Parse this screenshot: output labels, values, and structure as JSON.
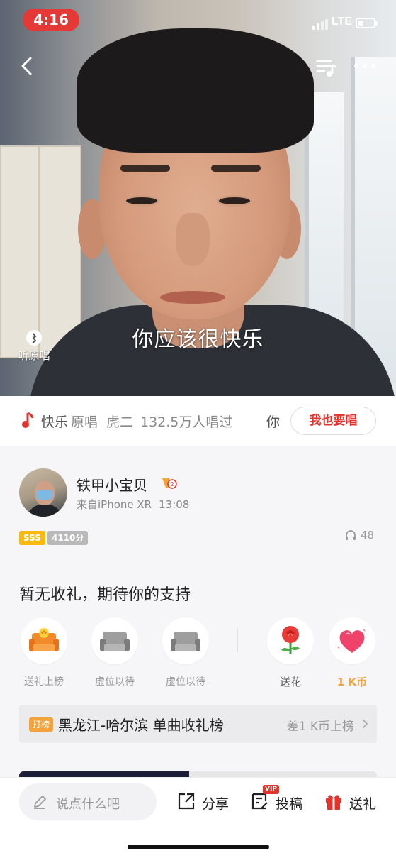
{
  "status": {
    "time": "4:16",
    "network": "LTE"
  },
  "video": {
    "lyric": "你应该很快乐",
    "listen_original": "听原唱"
  },
  "song": {
    "title": "快乐",
    "original_label": "原唱",
    "artist": "虎二",
    "sung_count": "132.5万人唱过",
    "next_fragment": "你",
    "sing_button": "我也要唱"
  },
  "user": {
    "name": "铁甲小宝贝",
    "device": "来自iPhone XR",
    "time": "13:08",
    "grade": "SSS",
    "score": "4110分",
    "listens": "48"
  },
  "gifts": {
    "title": "暂无收礼，期待你的支持",
    "slots": [
      {
        "label": "送礼上榜"
      },
      {
        "label": "虚位以待"
      },
      {
        "label": "虚位以待"
      }
    ],
    "flower_label": "送花",
    "coin_label": "1 K币"
  },
  "rank": {
    "tag": "打榜",
    "text": "黑龙江-哈尔滨 单曲收礼榜",
    "diff": "差1 K币上榜"
  },
  "bottom": {
    "comment_placeholder": "说点什么吧",
    "share": "分享",
    "contribute": "投稿",
    "contribute_badge": "VIP",
    "gift": "送礼"
  },
  "colors": {
    "accent_red": "#e5322d",
    "gold": "#f0a542",
    "sss_yellow": "#f9b90f"
  },
  "icons": [
    "back-icon",
    "playlist-icon",
    "more-icon",
    "music-note-icon",
    "headphone-icon",
    "pencil-icon",
    "share-icon",
    "contribute-icon",
    "gift-icon",
    "rose-icon",
    "heart-icon",
    "sofa-icon",
    "chevron-right-icon"
  ]
}
